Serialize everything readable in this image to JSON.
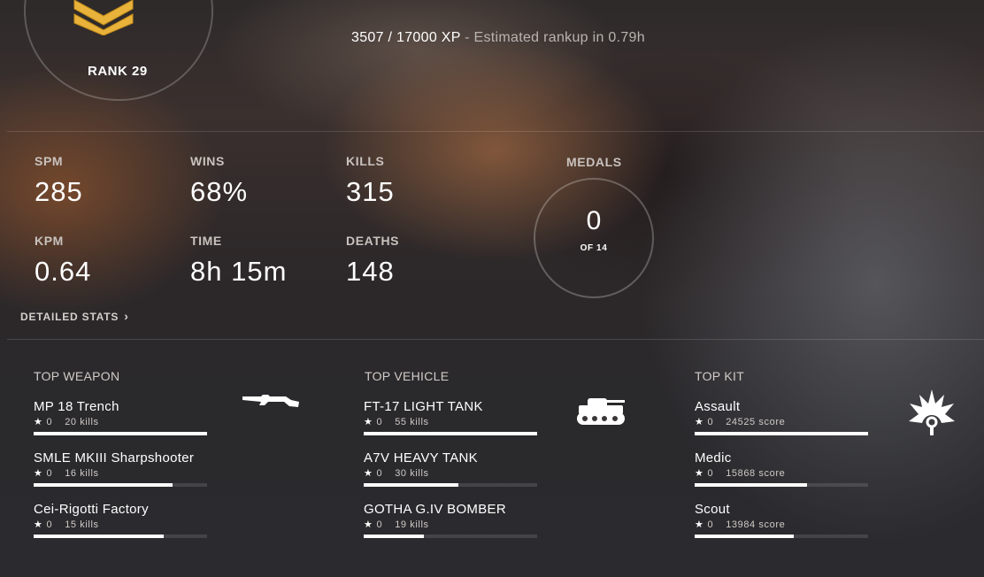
{
  "rank": {
    "label": "RANK 29"
  },
  "xp": {
    "value": "3507 / 17000 XP",
    "estimate": " - Estimated rankup in 0.79h"
  },
  "stats": {
    "spm": {
      "label": "SPM",
      "value": "285"
    },
    "wins": {
      "label": "WINS",
      "value": "68%"
    },
    "kills": {
      "label": "KILLS",
      "value": "315"
    },
    "kpm": {
      "label": "KPM",
      "value": "0.64"
    },
    "time": {
      "label": "TIME",
      "value": "8h 15m"
    },
    "deaths": {
      "label": "DEATHS",
      "value": "148"
    }
  },
  "detailed_stats": {
    "label": "DETAILED STATS"
  },
  "medals": {
    "title": "MEDALS",
    "count": "0",
    "of": "OF 14"
  },
  "columns": {
    "weapon": {
      "title": "TOP WEAPON",
      "icon": "rifle-icon",
      "items": [
        {
          "name": "MP 18 Trench",
          "stars": "0",
          "stat": "20 kills",
          "fraction": 1.0
        },
        {
          "name": "SMLE MKIII Sharpshooter",
          "stars": "0",
          "stat": "16 kills",
          "fraction": 0.8
        },
        {
          "name": "Cei-Rigotti Factory",
          "stars": "0",
          "stat": "15 kills",
          "fraction": 0.75
        }
      ]
    },
    "vehicle": {
      "title": "TOP VEHICLE",
      "icon": "tank-icon",
      "items": [
        {
          "name": "FT-17 LIGHT TANK",
          "stars": "0",
          "stat": "55 kills",
          "fraction": 1.0
        },
        {
          "name": "A7V HEAVY TANK",
          "stars": "0",
          "stat": "30 kills",
          "fraction": 0.545
        },
        {
          "name": "GOTHA G.IV BOMBER",
          "stars": "0",
          "stat": "19 kills",
          "fraction": 0.345
        }
      ]
    },
    "kit": {
      "title": "TOP KIT",
      "icon": "assault-kit-icon",
      "items": [
        {
          "name": "Assault",
          "stars": "0",
          "stat": "24525 score",
          "fraction": 1.0
        },
        {
          "name": "Medic",
          "stars": "0",
          "stat": "15868 score",
          "fraction": 0.647
        },
        {
          "name": "Scout",
          "stars": "0",
          "stat": "13984 score",
          "fraction": 0.57
        }
      ]
    }
  },
  "colors": {
    "accent": "#ffffff",
    "rank_insignia": "#e9b23a",
    "track": "#3a3638"
  }
}
